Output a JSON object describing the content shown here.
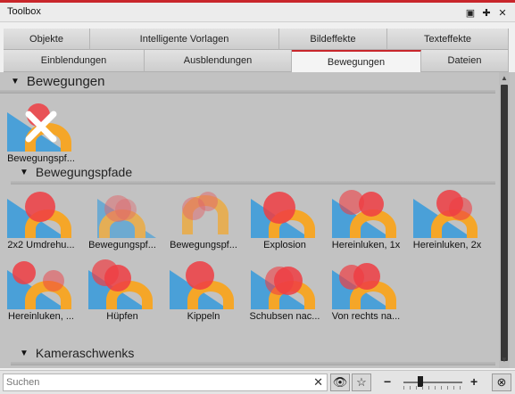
{
  "window": {
    "title": "Toolbox",
    "accent": "#c8262b"
  },
  "tabs_row1": [
    "Objekte",
    "Intelligente Vorlagen",
    "Bildeffekte",
    "Texteffekte"
  ],
  "tabs_row2": [
    "Einblendungen",
    "Ausblendungen",
    "Bewegungen",
    "Dateien"
  ],
  "active_tab": "Bewegungen",
  "sections": {
    "main": {
      "title": "Bewegungen"
    },
    "paths": {
      "title": "Bewegungspfade"
    },
    "pans": {
      "title": "Kameraschwenks"
    }
  },
  "main_items": [
    {
      "label": "Bewegungspf...",
      "icon": "motion-remove-icon"
    }
  ],
  "path_items": [
    {
      "label": "2x2 Umdrehu..."
    },
    {
      "label": "Bewegungspf..."
    },
    {
      "label": "Bewegungspf..."
    },
    {
      "label": "Explosion"
    },
    {
      "label": "Hereinluken, 1x"
    },
    {
      "label": "Hereinluken, 2x"
    },
    {
      "label": "Hereinluken, ..."
    },
    {
      "label": "Hüpfen"
    },
    {
      "label": "Kippeln"
    },
    {
      "label": "Schubsen nac..."
    },
    {
      "label": "Von rechts na..."
    }
  ],
  "search": {
    "placeholder": "Suchen",
    "value": ""
  },
  "icons": [
    "eye-icon",
    "star-icon",
    "zoom-minus-icon",
    "zoom-plus-icon",
    "zoom-reset-icon"
  ],
  "zoom": {
    "level": 0.3
  }
}
